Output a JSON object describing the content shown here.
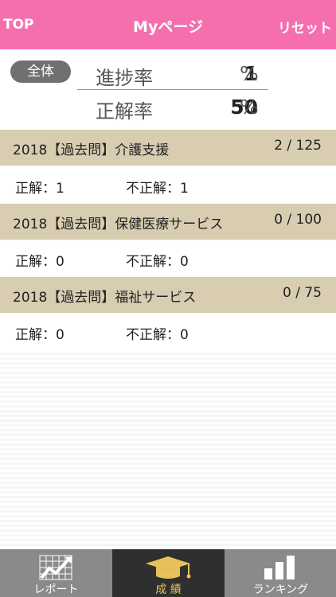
{
  "header": {
    "left_label": "TOP",
    "title": "Myページ",
    "right_label": "リセット"
  },
  "summary": {
    "badge": "全体",
    "progress_label": "進捗率",
    "progress_value": "1",
    "progress_unit": "%",
    "accuracy_label": "正解率",
    "accuracy_value": "50",
    "accuracy_unit": "%"
  },
  "categories": [
    {
      "title": "2018【過去問】介護支援",
      "count": "2 / 125",
      "correct": "正解：1",
      "incorrect": "不正解：1"
    },
    {
      "title": "2018【過去問】保健医療サービス",
      "count": "0 / 100",
      "correct": "正解：0",
      "incorrect": "不正解：0"
    },
    {
      "title": "2018【過去問】福祉サービス",
      "count": "0 / 75",
      "correct": "正解：0",
      "incorrect": "不正解：0"
    }
  ],
  "tabs": [
    {
      "label": "レポート",
      "icon": "chart-trend-icon",
      "active": false
    },
    {
      "label": "成 績",
      "icon": "graduation-cap-icon",
      "active": true
    },
    {
      "label": "ランキング",
      "icon": "bar-chart-icon",
      "active": false
    }
  ],
  "colors": {
    "header": "#f56fae",
    "category_header": "#d8ccb1",
    "tabbar": "#8a8a8a",
    "tab_active": "#2f2f2f",
    "tab_active_label": "#e8c15a"
  }
}
